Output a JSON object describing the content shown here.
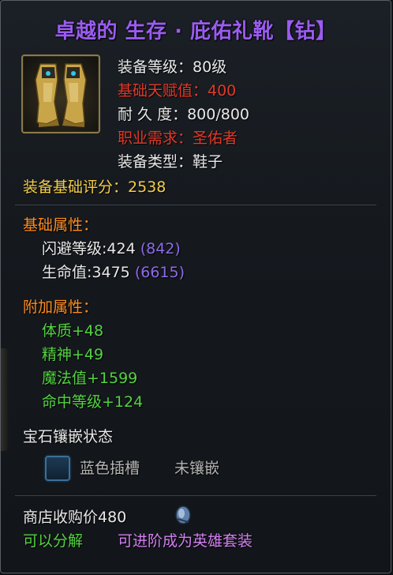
{
  "title": "卓越的 生存 · 庇佑礼靴【钻】",
  "stats": {
    "item_level": "装备等级：80级",
    "base_talent": "基础天赋值：400",
    "durability": "耐 久 度：800/800",
    "class_req": "职业需求：圣佑者",
    "equip_type": "装备类型：鞋子"
  },
  "score": "装备基础评分：2538",
  "base_attrs": {
    "header": "基础属性：",
    "items": [
      {
        "label": "闪避等级:424",
        "bonus": "(842)"
      },
      {
        "label": "生命值:3475",
        "bonus": "(6615)"
      }
    ]
  },
  "extra_attrs": {
    "header": "附加属性：",
    "items": [
      "体质+48",
      "精神+49",
      "魔法值+1599",
      "命中等级+124"
    ]
  },
  "gem": {
    "header": "宝石镶嵌状态",
    "slot_label": "蓝色插槽",
    "slot_status": "未镶嵌"
  },
  "shop_price": "商店收购价480",
  "decomposable": "可以分解",
  "upgrade": "可进阶成为英雄套装",
  "colors": {
    "title": "#9a5cf0",
    "red": "#e23a2a",
    "gold": "#f4cd4a",
    "orange": "#ff8c1e",
    "green": "#53d341",
    "purple": "#8f6ae8",
    "pink": "#d37ff2"
  },
  "icons": {
    "item": "boots-icon",
    "gem_slot": "blue-gem-slot-icon",
    "currency": "coin-icon"
  }
}
